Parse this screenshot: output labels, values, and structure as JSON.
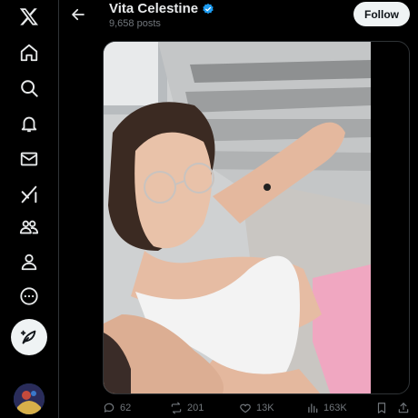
{
  "colors": {
    "accent": "#1d9bf0",
    "background": "#000000",
    "text_primary": "#e7e9ea",
    "text_secondary": "#71767b",
    "border": "#2f3336",
    "follow_bg": "#eff3f4"
  },
  "sidebar": {
    "items": [
      {
        "icon": "x-logo-icon"
      },
      {
        "icon": "home-icon"
      },
      {
        "icon": "search-icon"
      },
      {
        "icon": "notifications-bell-icon"
      },
      {
        "icon": "messages-envelope-icon"
      },
      {
        "icon": "grok-icon"
      },
      {
        "icon": "communities-icon"
      },
      {
        "icon": "profile-icon"
      },
      {
        "icon": "more-circle-icon"
      }
    ],
    "compose_icon": "compose-feather-icon",
    "avatar": "account-avatar"
  },
  "header": {
    "back_icon": "back-arrow-icon",
    "name": "Vita Celestine",
    "verified_icon": "verified-badge-icon",
    "posts_count": "9,658 posts",
    "follow_label": "Follow"
  },
  "media": {
    "description_icon": "photo"
  },
  "actions": {
    "replies": "62",
    "reposts": "201",
    "likes": "13K",
    "views": "163K"
  }
}
